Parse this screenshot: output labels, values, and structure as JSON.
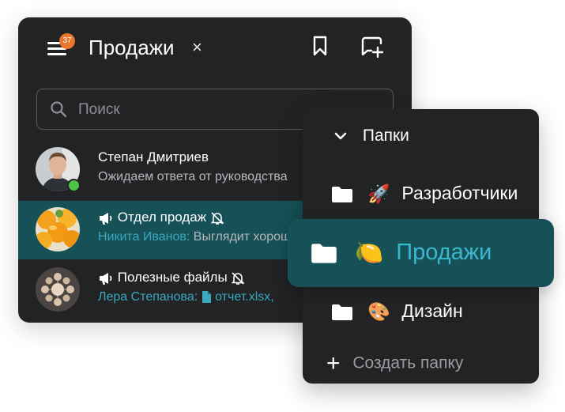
{
  "header": {
    "title": "Продажи",
    "notification_count": "37",
    "close_icon": "×",
    "menu_icon": "hamburger-icon",
    "bookmark_icon": "bookmark-icon",
    "new_chat_icon": "new-chat-icon"
  },
  "search": {
    "placeholder": "Поиск"
  },
  "chats": [
    {
      "name": "Степан Дмитриев",
      "message": "Ожидаем ответа от руководства",
      "online": true
    },
    {
      "name": "Отдел продаж",
      "sender": "Никита Иванов:",
      "message": "Выглядит хорошо",
      "muted": true,
      "channel": true
    },
    {
      "name": "Полезные файлы",
      "sender": "Лера Степанова:",
      "file": "отчет.xlsx,",
      "muted": true,
      "channel": true
    }
  ],
  "folders": {
    "header": "Папки",
    "items": [
      {
        "emoji": "🚀",
        "label": "Разработчики"
      },
      {
        "emoji": "🍋",
        "label": "Продажи",
        "active": true
      },
      {
        "emoji": "🎨",
        "label": "Дизайн"
      }
    ],
    "create_label": "Создать папку"
  },
  "colors": {
    "panel_bg": "#222325",
    "active_bg": "#165157",
    "accent": "#3aa8c1",
    "badge": "#e8762b",
    "online": "#4cc34a"
  }
}
